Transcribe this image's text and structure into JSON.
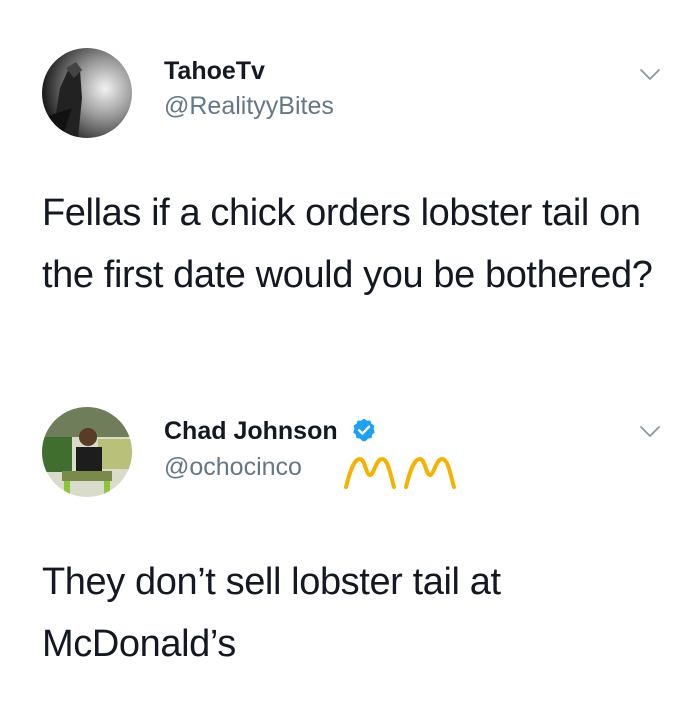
{
  "tweets": [
    {
      "display_name": "TahoeTv",
      "handle": "@RealityyBites",
      "text": "Fellas if a chick orders lobster tail on the first date would you be bothered?",
      "verified": false,
      "icons": {
        "menu": "chevron-down-icon"
      }
    },
    {
      "display_name": "Chad Johnson",
      "handle": "@ochocinco",
      "text": "They don’t sell lobster tail at McDonald’s",
      "verified": true,
      "handle_suffix_emoji": "golden-arches-emoji",
      "icons": {
        "menu": "chevron-down-icon",
        "badge": "verified-badge-icon"
      }
    }
  ],
  "colors": {
    "text": "#141823",
    "secondary_text": "#657786",
    "verified_blue": "#1DA1F2",
    "arches_yellow": "#F5B200"
  }
}
